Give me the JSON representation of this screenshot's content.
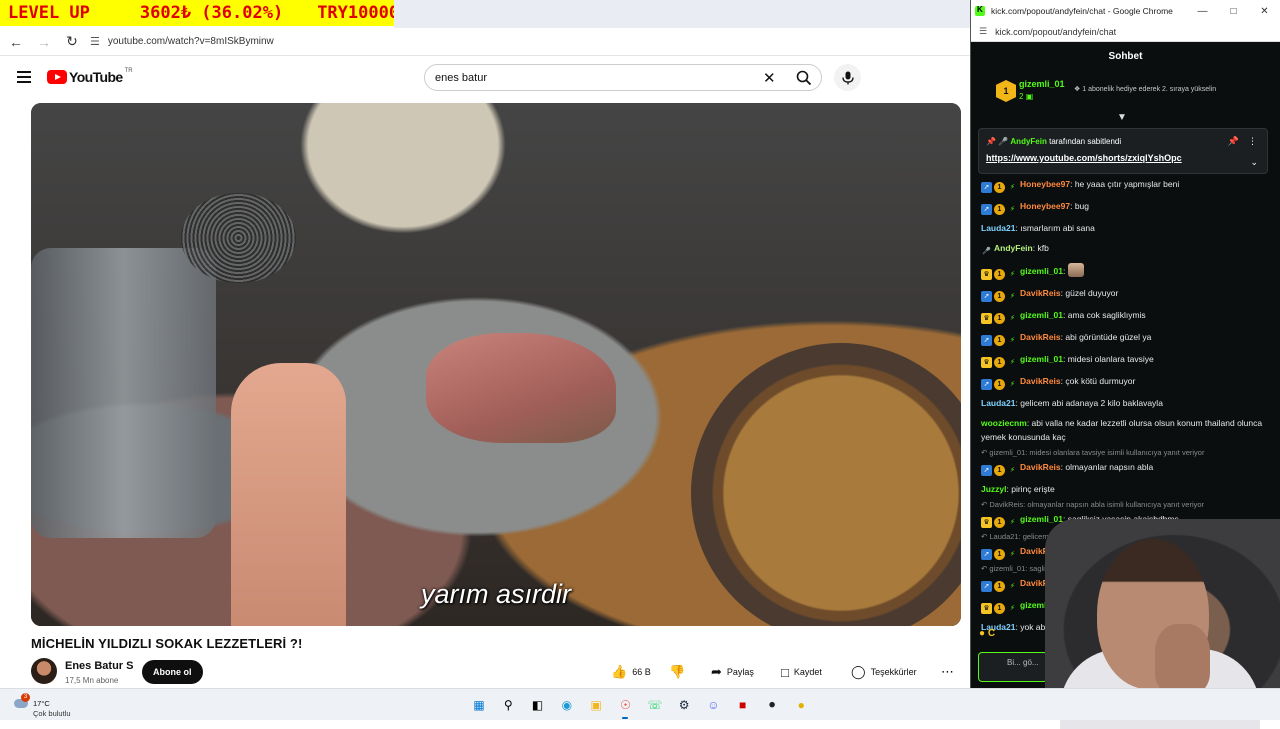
{
  "overlay": {
    "level": "LEVEL UP",
    "amount": "3602₺ (36.02%)",
    "goal": "TRY10000"
  },
  "browser": {
    "url": "youtube.com/watch?v=8mISkByminw"
  },
  "youtube": {
    "logo_text": "YouTube",
    "country_code": "TR",
    "search_value": "enes batur",
    "subtitle": "yarım asırdir",
    "video_title": "MİCHELİN YILDIZLI SOKAK LEZZETLERİ ?!",
    "channel_name": "Enes Batur S",
    "subscribers": "17,5 Mn abone",
    "subscribe_label": "Abone ol",
    "likes": "66 B",
    "share_label": "Paylaş",
    "save_label": "Kaydet",
    "thanks_label": "Teşekkürler"
  },
  "kick": {
    "window_title": "kick.com/popout/andyfein/chat - Google Chrome",
    "url": "kick.com/popout/andyfein/chat",
    "chat_title": "Sohbet",
    "leader": {
      "rank": "1",
      "name": "gizemli_01",
      "count": "2",
      "promo": "1 abonelik hediye ederek 2. sıraya yükselin"
    },
    "pinned": {
      "by_user": "AndyFein",
      "by_text": "tarafından sabitlendi",
      "link": "https://www.youtube.com/shorts/zxiqlYshOpc"
    },
    "messages": [
      {
        "type": "msg",
        "badges": [
          "blue",
          "gold",
          "bolt"
        ],
        "user": "Honeybee97",
        "color": "#ff8a3d",
        "text": ": he yaaa çıtır yapmışlar beni"
      },
      {
        "type": "msg",
        "badges": [
          "blue",
          "gold",
          "bolt"
        ],
        "user": "Honeybee97",
        "color": "#ff8a3d",
        "text": ": bug"
      },
      {
        "type": "msg",
        "badges": [],
        "user": "Lauda21",
        "color": "#7fd1ff",
        "text": ": ısmarlarım abi sana"
      },
      {
        "type": "msg",
        "badges": [
          "mic"
        ],
        "user": "AndyFein",
        "color": "#b4f07a",
        "text": ": kfb"
      },
      {
        "type": "msg",
        "badges": [
          "crown",
          "gold",
          "bolt"
        ],
        "user": "gizemli_01",
        "color": "#53fc18",
        "text": ":",
        "emote": true
      },
      {
        "type": "msg",
        "badges": [
          "blue",
          "gold",
          "bolt"
        ],
        "user": "DavikReis",
        "color": "#ff8a3d",
        "text": ": güzel duyuyor"
      },
      {
        "type": "msg",
        "badges": [
          "crown",
          "gold",
          "bolt"
        ],
        "user": "gizemli_01",
        "color": "#53fc18",
        "text": ": ama cok sagliklıymis"
      },
      {
        "type": "msg",
        "badges": [
          "blue",
          "gold",
          "bolt"
        ],
        "user": "DavikReis",
        "color": "#ff8a3d",
        "text": ": abi görüntüde güzel ya"
      },
      {
        "type": "msg",
        "badges": [
          "crown",
          "gold",
          "bolt"
        ],
        "user": "gizemli_01",
        "color": "#53fc18",
        "text": ": midesi olanlara tavsiye"
      },
      {
        "type": "msg",
        "badges": [
          "blue",
          "gold",
          "bolt"
        ],
        "user": "DavikReis",
        "color": "#ff8a3d",
        "text": ": çok kötü durmuyor"
      },
      {
        "type": "msg",
        "badges": [],
        "user": "Lauda21",
        "color": "#7fd1ff",
        "text": ": gelicem abi adanaya 2 kilo baklavayla"
      },
      {
        "type": "msg",
        "badges": [],
        "user": "wooziecnm",
        "color": "#53fc18",
        "text": ": abi valla ne kadar lezzetli olursa olsun konum thailand olunca yemek konusunda kaç"
      },
      {
        "type": "reply",
        "text": "gizemli_01: midesi olanlara tavsiye isimli kullanıcıya yanıt veriyor"
      },
      {
        "type": "msg",
        "badges": [
          "blue",
          "gold",
          "bolt"
        ],
        "user": "DavikReis",
        "color": "#ff8a3d",
        "text": ": olmayanlar napsın abla"
      },
      {
        "type": "msg",
        "badges": [],
        "user": "Juzzyl",
        "color": "#53fc18",
        "text": ": pirinç erişte"
      },
      {
        "type": "reply",
        "text": "DavikReis: olmayanlar napsın abla isimli kullanıcıya yanıt veriyor"
      },
      {
        "type": "msg",
        "badges": [
          "crown",
          "gold",
          "bolt"
        ],
        "user": "gizemli_01",
        "color": "#53fc18",
        "text": ": sagliksiz yasasin akajsbdbms"
      },
      {
        "type": "reply",
        "text": "Lauda21: gelicem abi adanaya ... isimli kullanıcıya yanıt veriyor"
      },
      {
        "type": "msg",
        "badges": [
          "blue",
          "gold",
          "bolt"
        ],
        "user": "DavikReis",
        "color": "#ff8a3d",
        "text": ": ya... yer zaten"
      },
      {
        "type": "reply",
        "text": "gizemli_01: sagliksiz ... isimli kullanıcıya yanıt veri..."
      },
      {
        "type": "msg",
        "badges": [
          "blue",
          "gold",
          "bolt"
        ],
        "user": "DavikReis",
        "color": "#ff8a3d",
        "text": ": p..."
      },
      {
        "type": "msg",
        "badges": [
          "crown",
          "gold",
          "bolt"
        ],
        "user": "gizemli",
        "color": "#53fc18",
        "text": ""
      },
      {
        "type": "msg",
        "badges": [],
        "user": "Lauda21",
        "color": "#7fd1ff",
        "text": ": yok abi ..."
      }
    ],
    "input_placeholder": "Bi... gö..."
  },
  "taskbar": {
    "weather_temp": "17°C",
    "weather_cond": "Çok bulutlu",
    "weather_badge": "3"
  }
}
